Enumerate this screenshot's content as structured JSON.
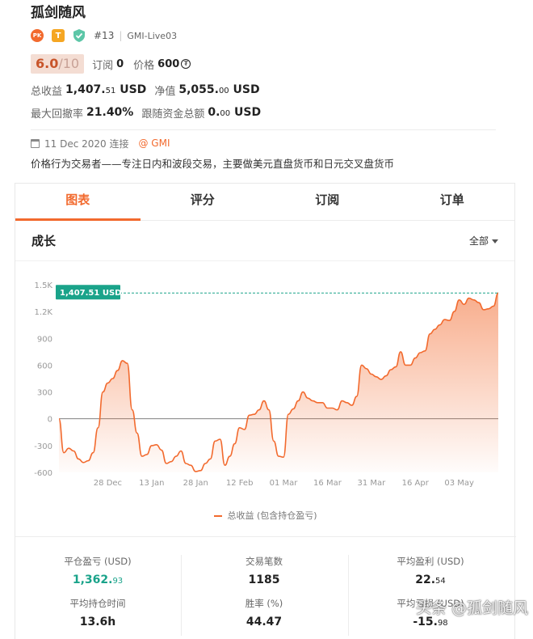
{
  "trader": {
    "name": "孤剑随风",
    "badge_pk": "PK",
    "badge_t": "T",
    "rank": "#13",
    "account": "GMI-Live03"
  },
  "rating": {
    "score": "6.0",
    "max": "/10",
    "subscribe_label": "订阅",
    "subscribe_value": "0",
    "price_label": "价格",
    "price_value": "600",
    "coin_symbol": "₮"
  },
  "stats_top": {
    "total_profit_label": "总收益",
    "total_profit_main": "1,407.",
    "total_profit_dec": "51",
    "total_profit_unit": " USD",
    "equity_label": "净值",
    "equity_main": "5,055.",
    "equity_dec": "00",
    "equity_unit": " USD",
    "max_dd_label": "最大回撤率",
    "max_dd_value": "21.40%",
    "follow_label": "跟随资金总额",
    "follow_main": "0.",
    "follow_dec": "00",
    "follow_unit": " USD"
  },
  "connect": {
    "date": "11 Dec 2020 连接",
    "broker": "@ GMI"
  },
  "description": "价格行为交易者——专注日内和波段交易，主要做美元直盘货币和日元交叉盘货币",
  "tabs": [
    "图表",
    "评分",
    "订阅",
    "订单"
  ],
  "section": {
    "title": "成长",
    "range": "全部"
  },
  "legend": "总收益 (包含持仓盈亏)",
  "bottom_stats": {
    "closed_pl_label": "平仓盈亏 (USD)",
    "closed_pl_main": "1,362.",
    "closed_pl_dec": "93",
    "trades_label": "交易笔数",
    "trades_value": "1185",
    "avg_profit_label": "平均盈利 (USD)",
    "avg_profit_main": "22.",
    "avg_profit_dec": "54",
    "avg_hold_label": "平均持仓时间",
    "avg_hold_value": "13.6h",
    "win_rate_label": "胜率 (%)",
    "win_rate_value": "44.47",
    "avg_loss_label": "平均亏损 (USD)",
    "avg_loss_main": "-15.",
    "avg_loss_dec": "98"
  },
  "watermark": "头条 @孤剑随风",
  "colors": {
    "accent": "#f26a2e",
    "green": "#1aa38a",
    "line": "#f26a2e"
  },
  "chart_data": {
    "type": "area",
    "title": "",
    "xlabel": "",
    "ylabel": "",
    "ylim": [
      -600,
      1500
    ],
    "y_ticks": [
      1500,
      1200,
      900,
      600,
      300,
      0,
      -300,
      -600
    ],
    "y_tick_labels": [
      "1.5K",
      "1.2K",
      "900",
      "600",
      "300",
      "0",
      "-300",
      "-600"
    ],
    "x_tick_labels": [
      "28 Dec",
      "13 Jan",
      "28 Jan",
      "12 Feb",
      "01 Mar",
      "16 Mar",
      "31 Mar",
      "16 Apr",
      "03 May"
    ],
    "x_tick_index": [
      10,
      19,
      28,
      37,
      46,
      55,
      64,
      73,
      82
    ],
    "last_value_label": "1,407.51 USD",
    "last_value": 1407.51,
    "series": [
      {
        "values": [
          0,
          -380,
          -330,
          -360,
          -450,
          -490,
          -470,
          -380,
          -100,
          300,
          400,
          450,
          540,
          650,
          620,
          100,
          -160,
          -420,
          -400,
          -300,
          -290,
          -350,
          -500,
          -480,
          -420,
          -360,
          -500,
          -520,
          -590,
          -580,
          -500,
          -450,
          -250,
          -230,
          -520,
          -420,
          -280,
          -100,
          -120,
          40,
          50,
          100,
          200,
          100,
          -250,
          -420,
          -430,
          50,
          110,
          200,
          300,
          230,
          200,
          180,
          180,
          120,
          120,
          100,
          200,
          180,
          150,
          250,
          600,
          560,
          500,
          470,
          440,
          480,
          550,
          580,
          750,
          600,
          600,
          680,
          740,
          760,
          950,
          1000,
          1050,
          1110,
          1100,
          1200,
          1330,
          1280,
          1350,
          1330,
          1300,
          1220,
          1230,
          1260,
          1407.51
        ]
      }
    ]
  }
}
